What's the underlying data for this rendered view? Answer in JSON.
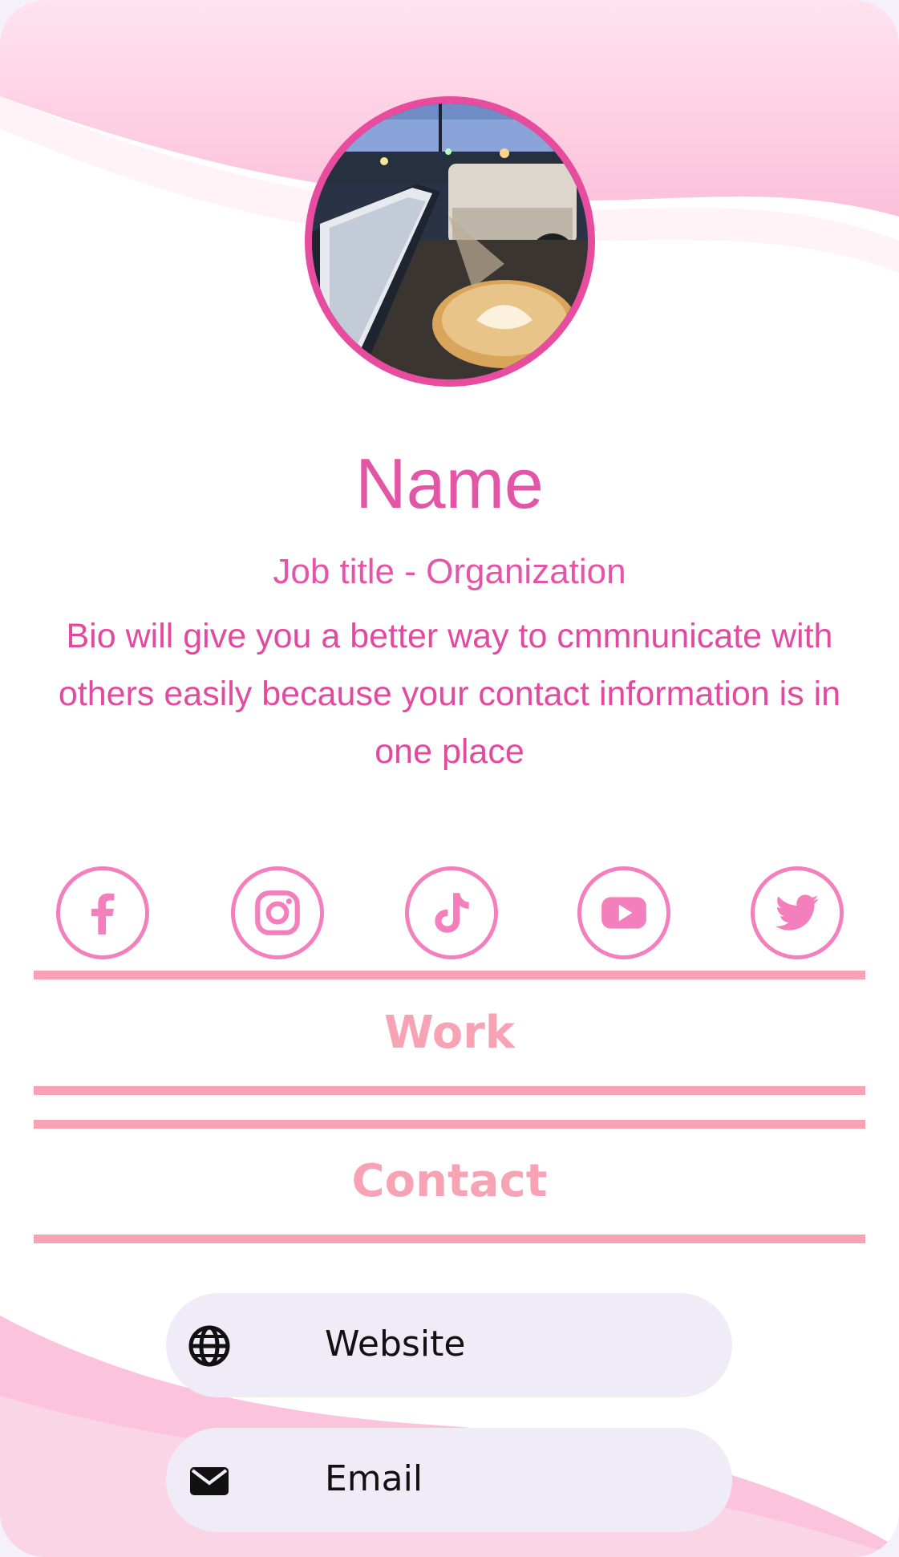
{
  "profile": {
    "name": "Name",
    "job": "Job title - Organization",
    "bio": "Bio will give you a better way to cmmnunicate with others easily because your contact information is in one place"
  },
  "social": [
    {
      "name": "facebook-icon"
    },
    {
      "name": "instagram-icon"
    },
    {
      "name": "tiktok-icon"
    },
    {
      "name": "youtube-icon"
    },
    {
      "name": "twitter-icon"
    }
  ],
  "sections": {
    "work": "Work",
    "contact": "Contact"
  },
  "links": {
    "website": "Website",
    "email": "Email"
  },
  "colors": {
    "accent": "#e355a6",
    "social": "#f47fbd",
    "section": "#f7a3b3",
    "pill": "#efecf8"
  }
}
